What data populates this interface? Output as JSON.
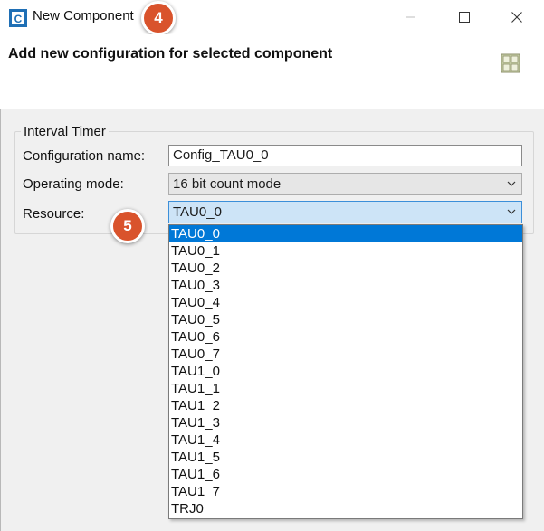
{
  "window": {
    "title": "New Component",
    "controls": [
      "minimize-icon",
      "maximize-icon",
      "close-icon"
    ]
  },
  "header": {
    "title": "Add new configuration for selected component",
    "icon": "grid-component-icon"
  },
  "callouts": {
    "first": "4",
    "second": "5"
  },
  "group": {
    "title": "Interval Timer",
    "fields": {
      "config_name_label": "Configuration name:",
      "config_name_value": "Config_TAU0_0",
      "operating_mode_label": "Operating mode:",
      "operating_mode_value": "16 bit count mode",
      "resource_label": "Resource:",
      "resource_value": "TAU0_0"
    }
  },
  "resource_options": [
    "TAU0_0",
    "TAU0_1",
    "TAU0_2",
    "TAU0_3",
    "TAU0_4",
    "TAU0_5",
    "TAU0_6",
    "TAU0_7",
    "TAU1_0",
    "TAU1_1",
    "TAU1_2",
    "TAU1_3",
    "TAU1_4",
    "TAU1_5",
    "TAU1_6",
    "TAU1_7",
    "TRJ0"
  ],
  "selected_option_index": 0,
  "colors": {
    "callout": "#d9532c",
    "selection": "#0078d7",
    "focus_combo": "#cde4f7"
  }
}
